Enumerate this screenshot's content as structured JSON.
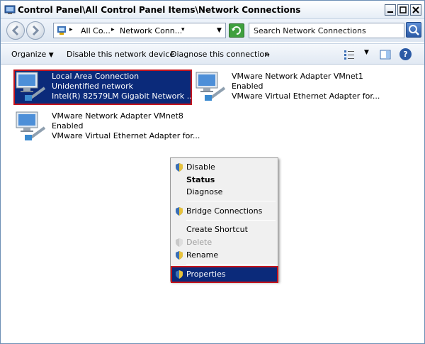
{
  "window": {
    "title": "Control Panel\\All Control Panel Items\\Network Connections"
  },
  "address": {
    "crumbs": [
      "All Co...",
      "Network Conn..."
    ],
    "search_placeholder": "Search Network Connections"
  },
  "toolbar": {
    "organize": "Organize",
    "organize_arrow": "▼",
    "disable": "Disable this network device",
    "diagnose": "Diagnose this connection",
    "more": "»",
    "help": "?"
  },
  "connections": [
    {
      "name": "Local Area Connection",
      "status": "Unidentified network",
      "device": "Intel(R) 82579LM Gigabit Network ..."
    },
    {
      "name": "VMware Network Adapter VMnet1",
      "status": "Enabled",
      "device": "VMware Virtual Ethernet Adapter for..."
    },
    {
      "name": "VMware Network Adapter VMnet8",
      "status": "Enabled",
      "device": "VMware Virtual Ethernet Adapter for..."
    }
  ],
  "context_menu": {
    "items": [
      "Disable",
      "Status",
      "Diagnose",
      "Bridge Connections",
      "Create Shortcut",
      "Delete",
      "Rename",
      "Properties"
    ]
  },
  "colors": {
    "selection": "#0b2a7a",
    "highlight_border": "#c4141c"
  }
}
